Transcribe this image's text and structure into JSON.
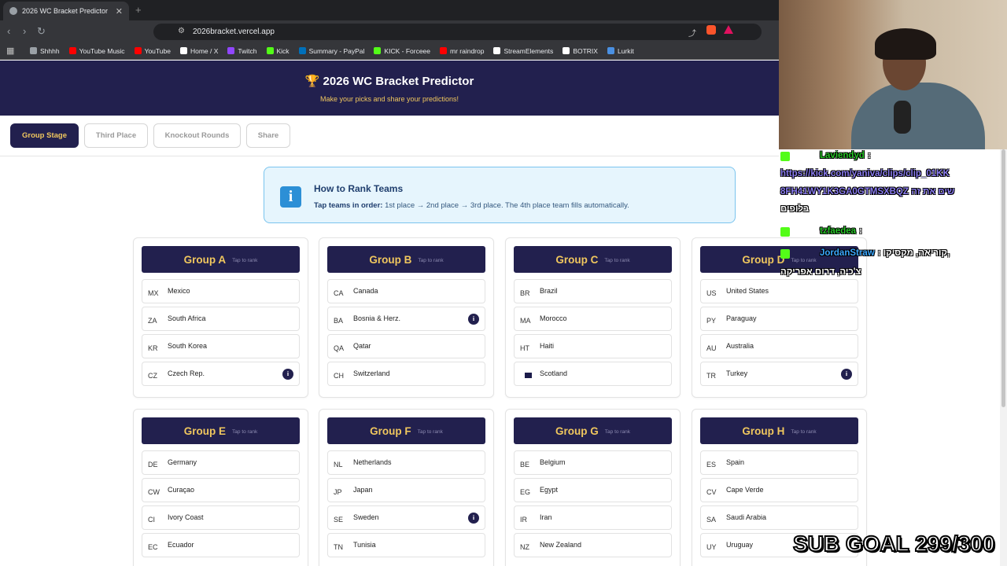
{
  "browser": {
    "tab_title": "2026 WC Bracket Predictor",
    "url": "2026bracket.vercel.app",
    "bookmarks": [
      {
        "label": "Shhhh",
        "color": "#9aa0a6"
      },
      {
        "label": "YouTube Music",
        "color": "#ff0000"
      },
      {
        "label": "YouTube",
        "color": "#ff0000"
      },
      {
        "label": "Home / X",
        "color": "#ffffff"
      },
      {
        "label": "Twitch",
        "color": "#9146ff"
      },
      {
        "label": "Kick",
        "color": "#53fc18"
      },
      {
        "label": "Summary - PayPal",
        "color": "#0070ba"
      },
      {
        "label": "KICK - Forceee",
        "color": "#53fc18"
      },
      {
        "label": "mr raindrop",
        "color": "#ff0000"
      },
      {
        "label": "StreamElements",
        "color": "#ffffff"
      },
      {
        "label": "BOTRIX",
        "color": "#ffffff"
      },
      {
        "label": "Lurkit",
        "color": "#4a90e2"
      }
    ]
  },
  "header": {
    "title": "🏆 2026 WC Bracket Predictor",
    "subtitle": "Make your picks and share your predictions!"
  },
  "nav_tabs": [
    "Group Stage",
    "Third Place",
    "Knockout Rounds",
    "Share"
  ],
  "info": {
    "heading": "How to Rank Teams",
    "lead": "Tap teams in order:",
    "text": " 1st place → 2nd place → 3rd place. The 4th place team fills automatically."
  },
  "tap_hint": "Tap to rank",
  "groups": [
    {
      "name": "Group A",
      "teams": [
        {
          "code": "MX",
          "name": "Mexico"
        },
        {
          "code": "ZA",
          "name": "South Africa"
        },
        {
          "code": "KR",
          "name": "South Korea"
        },
        {
          "code": "CZ",
          "name": "Czech Rep.",
          "info": true
        }
      ]
    },
    {
      "name": "Group B",
      "teams": [
        {
          "code": "CA",
          "name": "Canada"
        },
        {
          "code": "BA",
          "name": "Bosnia & Herz.",
          "info": true
        },
        {
          "code": "QA",
          "name": "Qatar"
        },
        {
          "code": "CH",
          "name": "Switzerland"
        }
      ]
    },
    {
      "name": "Group C",
      "teams": [
        {
          "code": "BR",
          "name": "Brazil"
        },
        {
          "code": "MA",
          "name": "Morocco"
        },
        {
          "code": "HT",
          "name": "Haiti"
        },
        {
          "code": "",
          "name": "Scotland",
          "flag": true
        }
      ]
    },
    {
      "name": "Group D",
      "teams": [
        {
          "code": "US",
          "name": "United States"
        },
        {
          "code": "PY",
          "name": "Paraguay"
        },
        {
          "code": "AU",
          "name": "Australia"
        },
        {
          "code": "TR",
          "name": "Turkey",
          "info": true
        }
      ]
    },
    {
      "name": "Group E",
      "teams": [
        {
          "code": "DE",
          "name": "Germany"
        },
        {
          "code": "CW",
          "name": "Curaçao"
        },
        {
          "code": "CI",
          "name": "Ivory Coast"
        },
        {
          "code": "EC",
          "name": "Ecuador"
        }
      ]
    },
    {
      "name": "Group F",
      "teams": [
        {
          "code": "NL",
          "name": "Netherlands"
        },
        {
          "code": "JP",
          "name": "Japan"
        },
        {
          "code": "SE",
          "name": "Sweden",
          "info": true
        },
        {
          "code": "TN",
          "name": "Tunisia"
        }
      ]
    },
    {
      "name": "Group G",
      "teams": [
        {
          "code": "BE",
          "name": "Belgium"
        },
        {
          "code": "EG",
          "name": "Egypt"
        },
        {
          "code": "IR",
          "name": "Iran"
        },
        {
          "code": "NZ",
          "name": "New Zealand"
        }
      ]
    },
    {
      "name": "Group H",
      "teams": [
        {
          "code": "ES",
          "name": "Spain"
        },
        {
          "code": "CV",
          "name": "Cape Verde"
        },
        {
          "code": "SA",
          "name": "Saudi Arabia"
        },
        {
          "code": "UY",
          "name": "Uruguay"
        }
      ]
    }
  ],
  "stream": {
    "chat": [
      {
        "user": "Laviendyd",
        "message": ":",
        "color": "#27c427"
      },
      {
        "user": "",
        "message": "https://kick.com/yaniva/clips/clip_01KK",
        "color": "#8a7cf0"
      },
      {
        "user": "",
        "message": "8FH41WY1K3GA0GTMSXBQZ שים את זה",
        "color": "#8a7cf0"
      },
      {
        "user": "",
        "message": "בלופים",
        "color": "#ffffff"
      },
      {
        "user": "tzfaedea",
        "message": ":",
        "color": "#27c427"
      },
      {
        "user": "JordanStraw",
        "message": ": קוריאה, מקסיקו,",
        "color": "#3ba8ff"
      },
      {
        "user": "",
        "message": "צ'כיה, דרום אפריקה",
        "color": "#ffffff"
      }
    ],
    "sub_goal": "SUB GOAL 299/300"
  }
}
